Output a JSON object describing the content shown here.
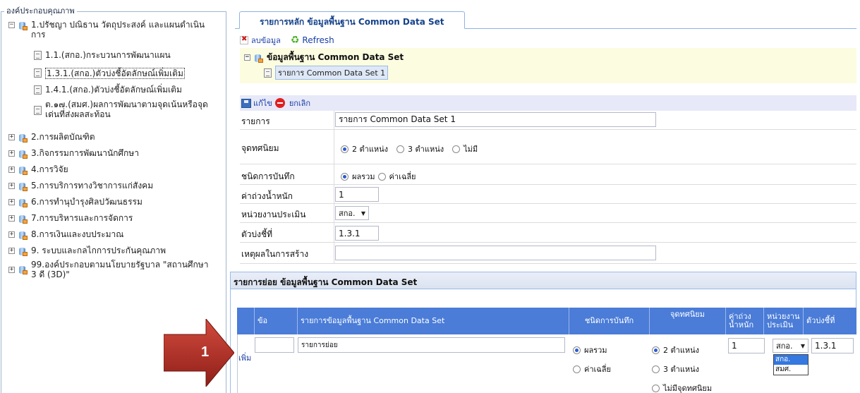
{
  "left_panel": {
    "title": "องค์ประกอบคุณภาพ",
    "nodes": [
      {
        "label": "1.ปรัชญา ปณิธาน วัตถุประสงค์ และแผนดำเนิน",
        "label2": "การ",
        "expander": "⊟"
      },
      {
        "label": "2.การผลิตบัณฑิต",
        "expander": "⊞"
      },
      {
        "label": "3.กิจกรรมการพัฒนานักศึกษา",
        "expander": "⊞"
      },
      {
        "label": "4.การวิจัย",
        "expander": "⊞"
      },
      {
        "label": "5.การบริการทางวิชาการแก่สังคม",
        "expander": "⊞"
      },
      {
        "label": "6.การทำนุบำรุงศิลปวัฒนธรรม",
        "expander": "⊞"
      },
      {
        "label": "7.การบริหารและการจัดการ",
        "expander": "⊞"
      },
      {
        "label": "8.การเงินและงบประมาณ",
        "expander": "⊞"
      },
      {
        "label": "9. ระบบและกลไกการประกันคุณภาพ",
        "expander": "⊞"
      },
      {
        "label": "99.องค์ประกอบตามนโยบายรัฐบาล \"สถานศึกษา",
        "label2": "3 ดี (3D)\"",
        "expander": "⊞"
      }
    ],
    "leaves": [
      {
        "label": "1.1.(สกอ.)กระบวนการพัฒนาแผน"
      },
      {
        "label": "1.3.1.(สกอ.)ตัวบ่งชี้อัตลักษณ์เพิ่มเติม"
      },
      {
        "label": "1.4.1.(สกอ.)ตัวบ่งชี้อัตลักษณ์เพิ่มเติม"
      },
      {
        "label": "ต.๑๗.(สมศ.)ผลการพัฒนาตามจุดเน้นหรือจุด",
        "label2": "เด่นที่ส่งผลสะท้อน"
      }
    ]
  },
  "tab": {
    "label": "รายการหลัก ข้อมูลพื้นฐาน Common Data Set"
  },
  "toolbar": {
    "delete_label": "ลบข้อมูล",
    "refresh_label": "Refresh"
  },
  "dataset_tree": {
    "root_label": "ข้อมูลพื้นฐาน Common Data Set",
    "child_label": "รายการ Common Data Set 1"
  },
  "edit_bar": {
    "edit_label": "แก้ไข",
    "cancel_label": "ยกเลิก"
  },
  "form": {
    "item_label": "รายการ",
    "item_value": "รายการ Common Data Set 1",
    "decimal_label": "จุดทศนิยม",
    "decimal_options": [
      "2 ตำแหน่ง",
      "3 ตำแหน่ง",
      "ไม่มี"
    ],
    "decimal_selected": "2 ตำแหน่ง",
    "record_type_label": "ชนิดการบันทึก",
    "record_type_options": [
      "ผลรวม",
      "ค่าเฉลี่ย"
    ],
    "record_type_selected": "ผลรวม",
    "weight_label": "ค่าถ่วงน้ำหนัก",
    "weight_value": "1",
    "unit_label": "หน่วยงานประเมิน",
    "unit_value": "สกอ.",
    "indicator_label": "ตัวบ่งชี้ที่",
    "indicator_value": "1.3.1",
    "reason_label": "เหตุผลในการสร้าง",
    "reason_value": ""
  },
  "sub_section": {
    "title": "รายการย่อย ข้อมูลพื้นฐาน Common Data Set",
    "columns": [
      "ข้อ",
      "รายการข้อมูลพื้นฐาน  Common Data Set",
      "ชนิดการบันทึก",
      "จุดทศนิยม",
      "ค่าถ่วง",
      "น้ำหนัก",
      "หน่วยงาน",
      "ประเมิน",
      "ตัวบ่งชี้ที่"
    ],
    "add_label": "เพิ่ม",
    "row": {
      "no_value": "",
      "name_value": "รายการย่อย",
      "record_options": [
        "ผลรวม",
        "ค่าเฉลี่ย"
      ],
      "decimal_options": [
        "2 ตำแหน่ง",
        "3 ตำแหน่ง",
        "ไม่มีจุดทศนิยม"
      ],
      "weight_value": "1",
      "unit_value": "สกอ.",
      "unit_dropdown": [
        "สกอ.",
        "สมศ."
      ],
      "indicator_value": "1.3.1"
    }
  },
  "step_marker": {
    "number": "1"
  },
  "colors": {
    "accent": "#15428b",
    "header_blue": "#4a7cd8",
    "yellow_bg": "#fcfce0",
    "arrow_red": "#b8322a"
  }
}
